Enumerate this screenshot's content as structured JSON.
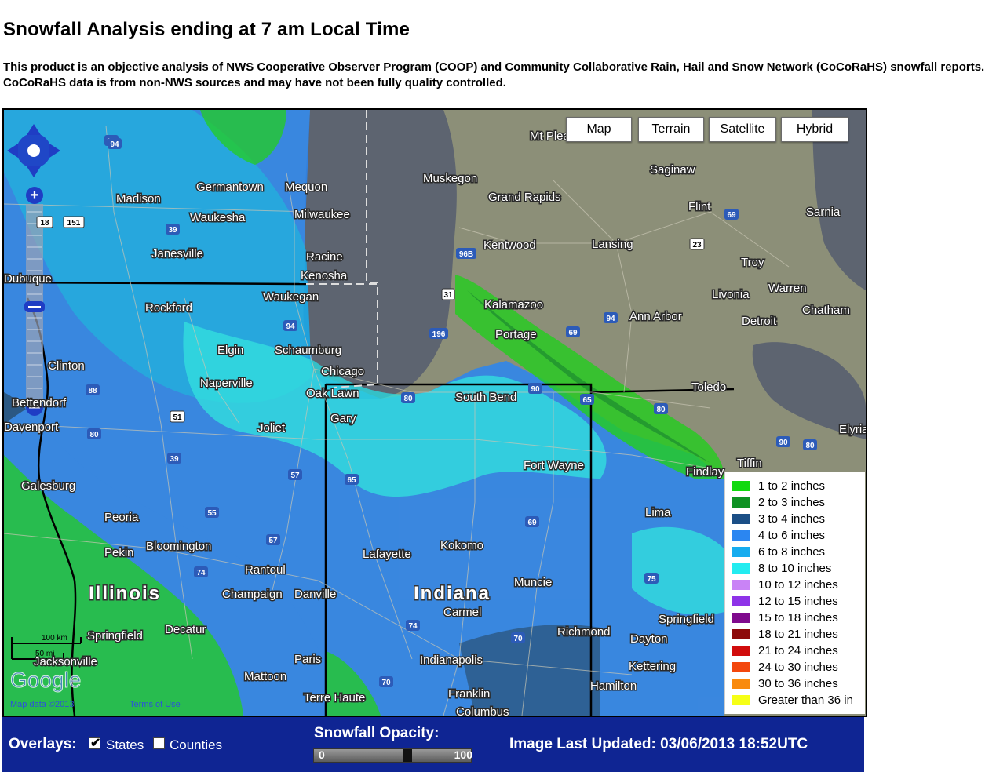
{
  "page": {
    "title": "Snowfall Analysis ending at 7 am Local Time",
    "description": "This product is an objective analysis of NWS Cooperative Observer Program (COOP) and Community Collaborative Rain, Hail and Snow Network (CoCoRaHS) snowfall reports.  CoCoRaHS data is from non-NWS sources and may have not been fully quality controlled."
  },
  "map_type_buttons": [
    "Map",
    "Terrain",
    "Satellite",
    "Hybrid"
  ],
  "map": {
    "state_labels": [
      "Illinois",
      "Indiana"
    ],
    "cities": [
      "Madison",
      "Germantown",
      "Mequon",
      "Milwaukee",
      "Waukesha",
      "Janesville",
      "Racine",
      "Kenosha",
      "Waukegan",
      "Rockford",
      "Elgin",
      "Schaumburg",
      "Chicago",
      "Naperville",
      "Oak Lawn",
      "Gary",
      "Joliet",
      "Clinton",
      "Bettendorf",
      "Davenport",
      "Galesburg",
      "Peoria",
      "Pekin",
      "Bloomington",
      "Rantoul",
      "Champaign",
      "Danville",
      "Decatur",
      "Springfield",
      "Jacksonville",
      "Paris",
      "Mattoon",
      "Terre Haute",
      "Lafayette",
      "Kokomo",
      "Carmel",
      "Muncie",
      "Indianapolis",
      "Franklin",
      "Columbus",
      "Richmond",
      "South Bend",
      "Fort Wayne",
      "Muskegon",
      "Grand Rapids",
      "Kentwood",
      "Kalamazoo",
      "Portage",
      "Lansing",
      "Saginaw",
      "Flint",
      "Sarnia",
      "Troy",
      "Warren",
      "Livonia",
      "Ann Arbor",
      "Detroit",
      "Chatham",
      "Toledo",
      "Findlay",
      "Tiffin",
      "Lima",
      "Elyria",
      "Dayton",
      "Springfield",
      "Kettering",
      "Hamilton",
      "Mt Pleasant",
      "Dubuque"
    ],
    "highway_shields": [
      "90",
      "94",
      "151",
      "18",
      "39",
      "94",
      "196",
      "96B",
      "31",
      "23",
      "69",
      "94",
      "69",
      "80",
      "88",
      "80",
      "51",
      "39",
      "57",
      "65",
      "55",
      "57",
      "74",
      "69",
      "80",
      "90",
      "70",
      "74",
      "75",
      "70",
      "65",
      "90",
      "80"
    ],
    "scale": {
      "km_label": "100 km",
      "mi_label": "50 mi"
    },
    "attribution": {
      "logo": "Google",
      "map_data": "Map data ©2013",
      "terms": "Terms of Use"
    }
  },
  "legend": {
    "items": [
      {
        "label": "1 to 2 inches",
        "color": "#11d90f"
      },
      {
        "label": "2 to 3 inches",
        "color": "#0e9223"
      },
      {
        "label": "3 to 4 inches",
        "color": "#1b4f86"
      },
      {
        "label": "4 to 6 inches",
        "color": "#2b86f1"
      },
      {
        "label": "6 to 8 inches",
        "color": "#16acef"
      },
      {
        "label": "8 to 10 inches",
        "color": "#23ecf0"
      },
      {
        "label": "10 to 12 inches",
        "color": "#c983f6"
      },
      {
        "label": "12 to 15 inches",
        "color": "#8e33e8"
      },
      {
        "label": "15 to 18 inches",
        "color": "#7f0a8d"
      },
      {
        "label": "18 to 21 inches",
        "color": "#8d0a0a"
      },
      {
        "label": "21 to 24 inches",
        "color": "#d10c0c"
      },
      {
        "label": "24 to 30 inches",
        "color": "#f3470d"
      },
      {
        "label": "30 to 36 inches",
        "color": "#f98a0e"
      },
      {
        "label": "Greater than 36 in",
        "color": "#f6ff16"
      }
    ]
  },
  "controls": {
    "overlays_label": "Overlays:",
    "states_label": "States",
    "states_checked": true,
    "counties_label": "Counties",
    "counties_checked": false,
    "opacity_label": "Snowfall Opacity:",
    "opacity_min": "0",
    "opacity_max": "100",
    "opacity_value_percent": 60,
    "last_updated": "Image Last Updated: 03/06/2013 18:52UTC"
  }
}
